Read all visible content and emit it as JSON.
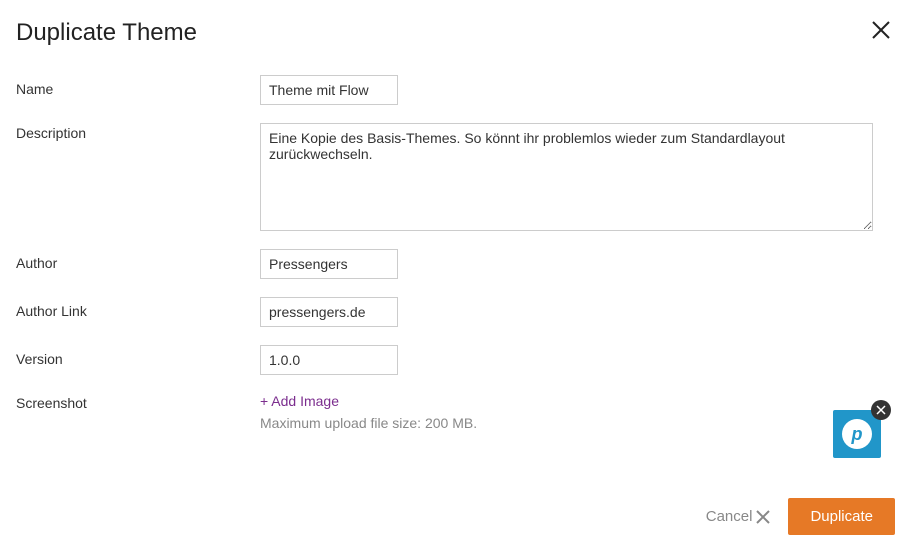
{
  "dialog": {
    "title": "Duplicate Theme"
  },
  "labels": {
    "name": "Name",
    "description": "Description",
    "author": "Author",
    "author_link": "Author Link",
    "version": "Version",
    "screenshot": "Screenshot"
  },
  "fields": {
    "name": "Theme mit Flow",
    "description": "Eine Kopie des Basis-Themes. So könnt ihr problemlos wieder zum Standardlayout zurückwechseln.",
    "author": "Pressengers",
    "author_link": "pressengers.de",
    "version": "1.0.0"
  },
  "screenshot": {
    "add_image": "+ Add Image",
    "upload_note": "Maximum upload file size: 200 MB."
  },
  "buttons": {
    "cancel": "Cancel",
    "duplicate": "Duplicate"
  },
  "widget": {
    "letter": "p"
  }
}
